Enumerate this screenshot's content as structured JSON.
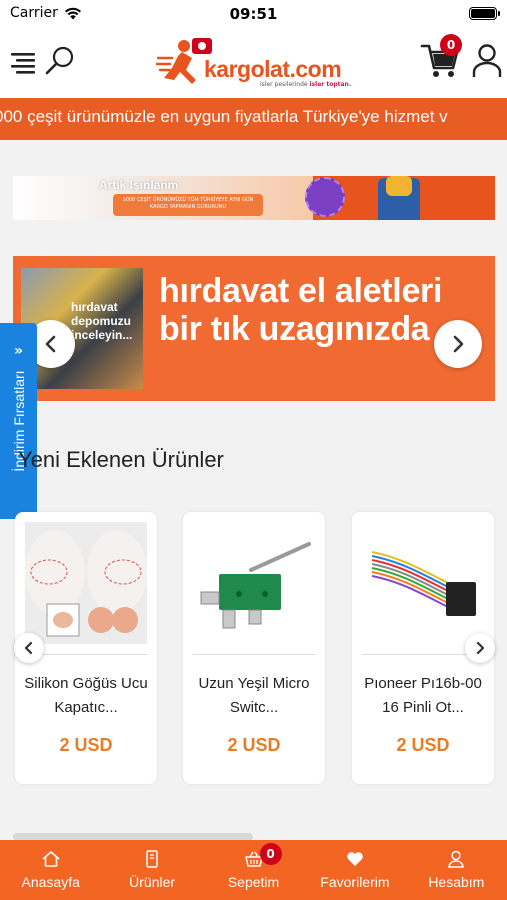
{
  "status_bar": {
    "carrier": "Carrier",
    "time": "09:51"
  },
  "header": {
    "logo_text": "kargolat.com",
    "logo_tagline_prefix": "isler pesilerinde",
    "logo_tagline_highlight": "isler toptan.",
    "cart_count": "0",
    "icons": [
      "menu-icon",
      "search-icon",
      "cart-icon",
      "user-icon"
    ]
  },
  "marquee": {
    "text": "000 çeşit ürünümüzle en uygun fiyatlarla Türkiye'ye hizmet v"
  },
  "small_banner": {
    "title": "Artık Işınlanm",
    "pill_text": "5000 ÇEŞİT ÜRÜNÜMÜZÜ TÜM TÜRKİYEYE AYNI GÜN KARGO YAPMANIN GURURUNU"
  },
  "hero_banner": {
    "headline": "hırdavat el aletleri bir tık uzagınızda ,",
    "photo_caption": "hırdavat depomuzu inceleyin..."
  },
  "side_tab": {
    "label": "İndirim Fırsatları",
    "arrow": "»"
  },
  "section": {
    "title": "Yeni Eklenen Ürünler"
  },
  "products": [
    {
      "name": "Silikon Göğüs Ucu Kapatıc...",
      "price": "2 USD"
    },
    {
      "name": "Uzun Yeşil Micro Switc...",
      "price": "2 USD"
    },
    {
      "name": "Pıoneer Pı16b-00 16 Pinli Ot...",
      "price": "2 USD"
    }
  ],
  "bottom_nav": {
    "items": [
      {
        "label": "Anasayfa",
        "icon": "home-icon"
      },
      {
        "label": "Ürünler",
        "icon": "products-icon"
      },
      {
        "label": "Sepetim",
        "icon": "basket-icon"
      },
      {
        "label": "Favorilerim",
        "icon": "heart-icon"
      },
      {
        "label": "Hesabım",
        "icon": "account-icon"
      }
    ],
    "cart_badge": "0"
  },
  "colors": {
    "brand_orange": "#f26522",
    "price_orange": "#e87d26",
    "side_tab_blue": "#1a83e0",
    "badge_red": "#d0021b"
  }
}
